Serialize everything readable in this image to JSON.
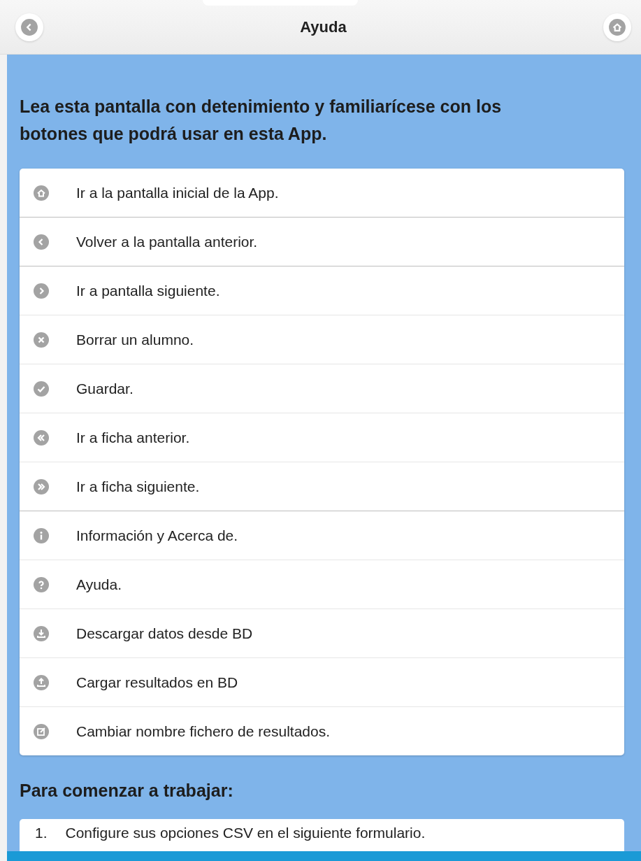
{
  "header": {
    "title": "Ayuda"
  },
  "intro": "Lea esta pantalla con detenimiento y familiarícese con los botones que podrá usar en esta App.",
  "buttons_list": [
    {
      "kind": "home",
      "label": "Ir a la pantalla inicial de la App."
    },
    {
      "kind": "back",
      "label": "Volver a la pantalla anterior."
    },
    {
      "kind": "next",
      "label": "Ir a pantalla siguiente."
    },
    {
      "kind": "delete",
      "label": "Borrar un alumno."
    },
    {
      "kind": "check",
      "label": "Guardar."
    },
    {
      "kind": "rewind",
      "label": "Ir a ficha anterior."
    },
    {
      "kind": "forward",
      "label": "Ir a ficha siguiente."
    },
    {
      "kind": "info",
      "label": "Información y Acerca de."
    },
    {
      "kind": "help",
      "label": "Ayuda."
    },
    {
      "kind": "download",
      "label": "Descargar datos desde BD"
    },
    {
      "kind": "upload",
      "label": "Cargar resultados en BD"
    },
    {
      "kind": "edit",
      "label": "Cambiar nombre fichero de resultados."
    }
  ],
  "start_heading": "Para comenzar a trabajar:",
  "steps": [
    {
      "number": "1.",
      "text": "Configure sus opciones CSV en el siguiente formulario."
    }
  ]
}
